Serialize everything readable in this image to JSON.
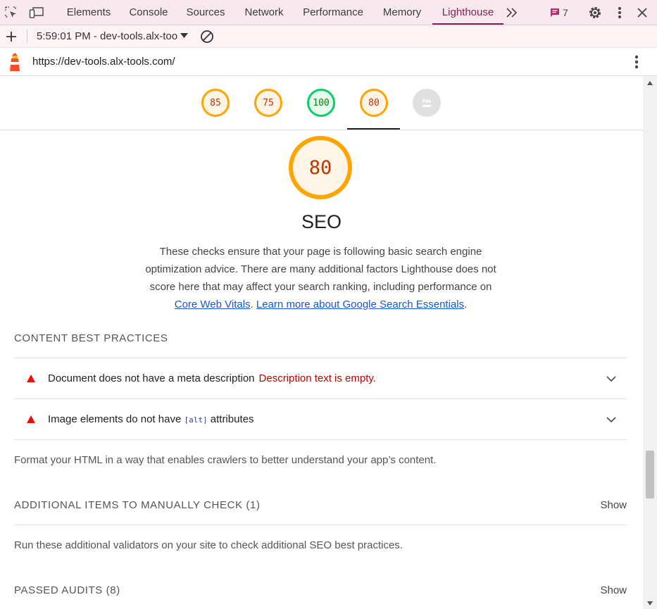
{
  "tabbar": {
    "tabs": [
      "Elements",
      "Console",
      "Sources",
      "Network",
      "Performance",
      "Memory",
      "Lighthouse"
    ],
    "active_tab": "Lighthouse",
    "issues_count": "7"
  },
  "toolbar": {
    "report_selector": "5:59:01 PM - dev-tools.alx-too"
  },
  "urlbar": {
    "url": "https://dev-tools.alx-tools.com/"
  },
  "gauges": [
    {
      "score": "85",
      "color": "#ffa400"
    },
    {
      "score": "75",
      "color": "#ffa400"
    },
    {
      "score": "100",
      "color": "#0cce6b"
    },
    {
      "score": "80",
      "color": "#ffa400"
    },
    {
      "score": "PWA",
      "color": "#e0e0e0"
    }
  ],
  "category": {
    "score": "80",
    "title": "SEO",
    "description": "These checks ensure that your page is following basic search engine optimization advice. There are many additional factors Lighthouse does not score here that may affect your search ranking, including performance on",
    "link1": "Core Web Vitals",
    "link_sep": ". ",
    "link2": "Learn more about Google Search Essentials",
    "link_end": "."
  },
  "content_best_practices": {
    "heading": "CONTENT BEST PRACTICES",
    "audits": [
      {
        "title": "Document does not have a meta description",
        "error": "Description text is empty."
      },
      {
        "title_pre": "Image elements do not have ",
        "code": "[alt]",
        "title_post": " attributes"
      }
    ],
    "footer": "Format your HTML in a way that enables crawlers to better understand your app’s content."
  },
  "manual": {
    "heading": "ADDITIONAL ITEMS TO MANUALLY CHECK",
    "count": "(1)",
    "show": "Show",
    "note": "Run these additional validators on your site to check additional SEO best practices."
  },
  "passed": {
    "heading": "PASSED AUDITS",
    "count": "(8)",
    "show": "Show"
  }
}
